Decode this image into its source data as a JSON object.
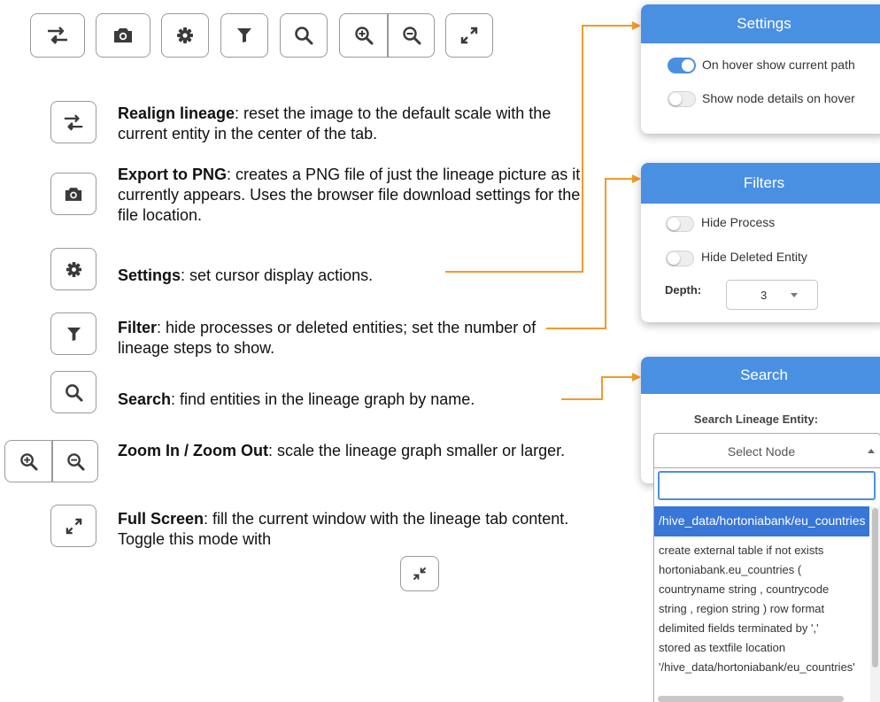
{
  "toolbar": {
    "realign_icon": "realign-icon",
    "export_icon": "camera-icon",
    "settings_icon": "gear-icon",
    "filter_icon": "filter-icon",
    "search_icon": "search-icon",
    "zoom_in_icon": "zoom-in-icon",
    "zoom_out_icon": "zoom-out-icon",
    "fullscreen_icon": "expand-icon"
  },
  "items": {
    "realign": {
      "title": "Realign lineage",
      "text": ": reset the image to the default scale with the current entity in the center of the tab."
    },
    "export": {
      "title": "Export to PNG",
      "text": ": creates a PNG file of just the lineage picture as it currently appears. Uses the browser file download settings for the file location."
    },
    "settings": {
      "title": "Settings",
      "text": ": set cursor display actions."
    },
    "filter": {
      "title": "Filter",
      "text": ": hide processes or deleted entities; set the number of lineage steps to show."
    },
    "search": {
      "title": "Search",
      "text": ": find entities in the lineage graph by name."
    },
    "zoom": {
      "title": "Zoom In / Zoom Out",
      "text": ": scale the lineage graph smaller or larger."
    },
    "fullscreen": {
      "title": "Full Screen",
      "text": ": fill the current window with the lineage tab content. Toggle this mode with"
    }
  },
  "settings_panel": {
    "title": "Settings",
    "close": "×",
    "options": [
      {
        "label": "On hover show current path",
        "on": true
      },
      {
        "label": "Show node details on hover",
        "on": false
      }
    ]
  },
  "filters_panel": {
    "title": "Filters",
    "close": "×",
    "options": [
      {
        "label": "Hide Process",
        "on": false
      },
      {
        "label": "Hide Deleted Entity",
        "on": false
      }
    ],
    "depth_label": "Depth:",
    "depth_value": "3"
  },
  "search_panel": {
    "title": "Search",
    "close": "×",
    "label": "Search Lineage Entity:",
    "select_placeholder": "Select Node",
    "search_value": "",
    "highlighted_option": "/hive_data/hortoniabank/eu_countries",
    "option_lines": [
      "create external table if not exists",
      "hortoniabank.eu_countries (",
      "countryname string , countrycode",
      "string , region string ) row format",
      "delimited fields terminated by ','",
      "stored as textfile location",
      "'/hive_data/hortoniabank/eu_countries'"
    ]
  },
  "colors": {
    "accent": "#4a90e2",
    "connector": "#f39a2b",
    "border": "#9a9a9a"
  }
}
